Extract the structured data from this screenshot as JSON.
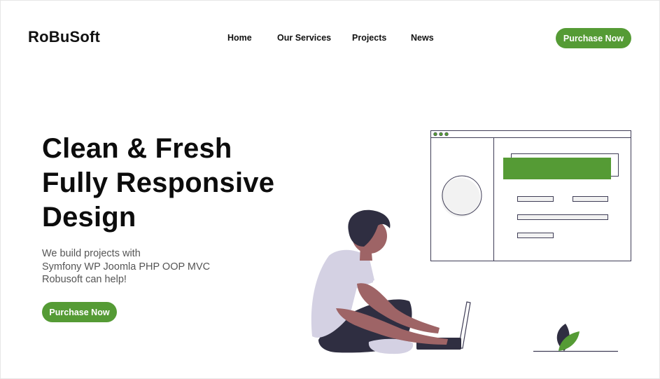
{
  "brand": {
    "logo_text": "RoBuSoft"
  },
  "nav": {
    "items": [
      {
        "label": "Home"
      },
      {
        "label": "Our Services"
      },
      {
        "label": "Projects"
      },
      {
        "label": "News"
      }
    ]
  },
  "header": {
    "cta_label": "Purchase Now"
  },
  "hero": {
    "title_lines": [
      "Clean & Fresh",
      "Fully Responsive",
      "Design"
    ],
    "subtitle_lines": [
      "We build projects with",
      "Symfony WP Joomla PHP OOP MVC",
      "Robusoft can help!"
    ],
    "cta_label": "Purchase Now"
  },
  "colors": {
    "accent": "#559b35",
    "text_dark": "#0c0c0c",
    "text_muted": "#555555",
    "figure_shirt": "#d4d1e3",
    "figure_skin": "#9e6466",
    "figure_dark": "#2f2e41"
  },
  "icons": {
    "browser_dots": "window-dots-icon",
    "plant": "leaf-plant-icon"
  }
}
